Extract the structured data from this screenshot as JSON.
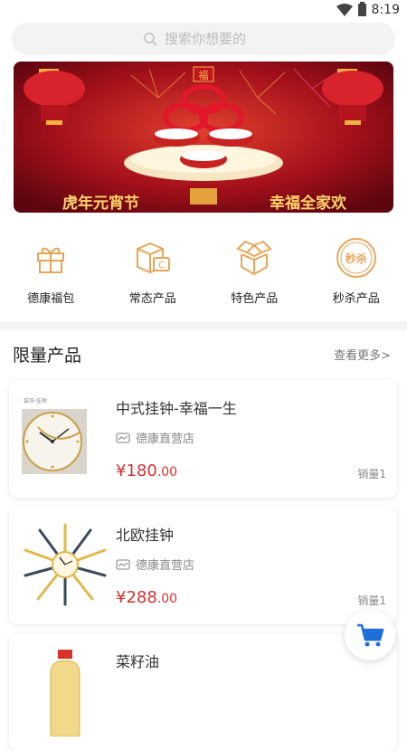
{
  "status_bar": {
    "time": "8:19"
  },
  "search": {
    "placeholder": "搜索你想要的"
  },
  "banner": {
    "left_text": "虎年元宵节",
    "right_text": "幸福全家欢"
  },
  "categories": [
    {
      "label": "德康福包",
      "icon": "gift-icon"
    },
    {
      "label": "常态产品",
      "icon": "box-coin-icon"
    },
    {
      "label": "特色产品",
      "icon": "open-box-icon"
    },
    {
      "label": "秒杀产品",
      "icon": "flash-sale-badge-icon",
      "badge": "秒杀"
    }
  ],
  "section": {
    "title": "限量产品",
    "more": "查看更多>"
  },
  "products": [
    {
      "name": "中式挂钟-幸福一生",
      "store": "德康直营店",
      "price_int": "¥180",
      "price_dec": ".00",
      "sales": "销量1",
      "image": "gold-wall-clock"
    },
    {
      "name": "北欧挂钟",
      "store": "德康直营店",
      "price_int": "¥288",
      "price_dec": ".00",
      "sales": "销量1",
      "image": "sunburst-wall-clock"
    },
    {
      "name": "菜籽油",
      "image": "oil-bottle"
    }
  ],
  "colors": {
    "accent_orange": "#e7a657",
    "price_red": "#d43030",
    "cart_blue": "#1e6fd9"
  }
}
